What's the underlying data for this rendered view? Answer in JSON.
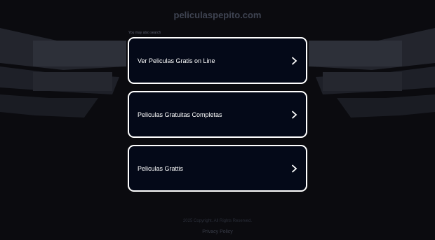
{
  "header": {
    "site_title": "peliculaspepito.com",
    "related_label": "You may also search"
  },
  "links": [
    {
      "label": "Ver Peliculas Gratis on Line",
      "icon": "chevron-right-icon"
    },
    {
      "label": "Peliculas Gratuitas Completas",
      "icon": "chevron-right-icon"
    },
    {
      "label": "Peliculas Grattis",
      "icon": "chevron-right-icon"
    }
  ],
  "footer": {
    "copyright": "2025 Copyright. All Rights Reserved.",
    "privacy": "Privacy Policy"
  },
  "colors": {
    "background": "#0b0b0f",
    "box_fill": "#040918",
    "box_border": "#ffffff",
    "deco": "#2a2d37"
  }
}
